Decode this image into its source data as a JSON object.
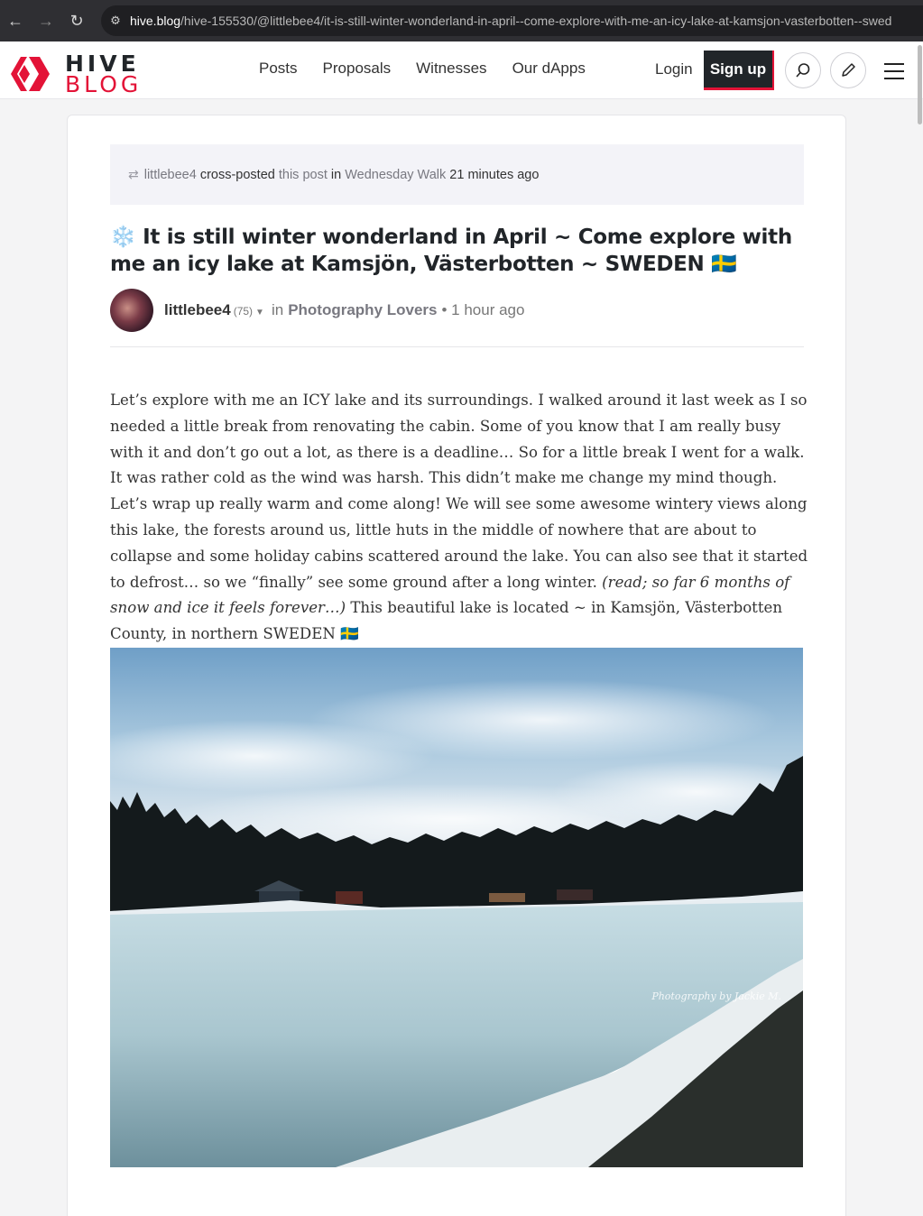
{
  "browser": {
    "url_host": "hive.blog",
    "url_path": "/hive-155530/@littlebee4/it-is-still-winter-wonderland-in-april--come-explore-with-me-an-icy-lake-at-kamsjon-vasterbotten--swed"
  },
  "header": {
    "logo_line1": "HIVE",
    "logo_line2": "BLOG",
    "nav": [
      "Posts",
      "Proposals",
      "Witnesses",
      "Our dApps"
    ],
    "login": "Login",
    "signup": "Sign up"
  },
  "crosspost": {
    "author": "littlebee4",
    "text1": "cross-posted",
    "link": "this post",
    "text2": "in",
    "community": "Wednesday Walk",
    "time": "21 minutes ago"
  },
  "post": {
    "title_emoji": "❄️",
    "title": "It is still winter wonderland in April ~ Come explore with me an icy lake at Kamsjön, Västerbotten ~ SWEDEN",
    "title_flag": "🇸🇪",
    "author": "littlebee4",
    "reputation": "(75)",
    "in_text": "in",
    "community": "Photography Lovers",
    "time": "• 1 hour ago",
    "body_1": "Let’s explore with me an ICY lake and its surroundings. I walked around it last week as I so needed a little break from renovating the cabin. Some of you know that I am really busy with it and don’t go out a lot, as there is a deadline… So for a little break I went for a walk. It was rather cold as the wind was harsh. This didn’t make me change my mind though. Let’s wrap up really warm and come along! We will see some awesome wintery views along this lake, the forests around us, little huts in the middle of nowhere that are about to collapse and some holiday cabins scattered around the lake. You can also see that it started to defrost… so we “finally” see some ground after a long winter.",
    "body_italic": "(read; so far 6 months of snow and ice it feels forever…)",
    "body_2": "This beautiful lake is located ~ in Kamsjön, Västerbotten County, in northern SWEDEN",
    "body_flag": "🇸🇪",
    "photo_credit": "Photography by Jackie M."
  },
  "colors": {
    "brand_red": "#e31337",
    "dark": "#212529"
  }
}
